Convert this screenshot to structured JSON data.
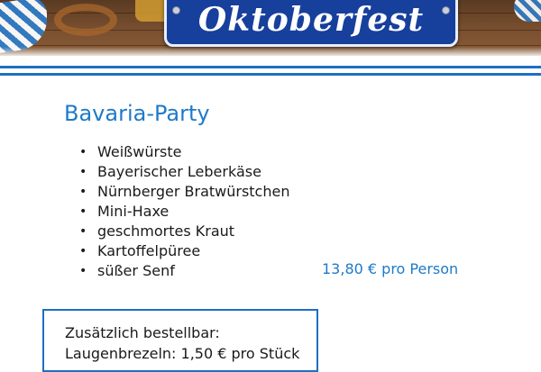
{
  "banner": {
    "title": "Oktoberfest"
  },
  "menu": {
    "title": "Bavaria-Party",
    "bullet": "•",
    "items": [
      "Weißwürste",
      "Bayerischer Leberkäse",
      "Nürnberger Bratwürstchen",
      "Mini-Haxe",
      "geschmortes Kraut",
      "Kartoffelpüree",
      "süßer Senf"
    ],
    "price": "13,80 € pro Person"
  },
  "extras": {
    "heading": "Zusätzlich bestellbar:",
    "line": "Laugenbrezeln: 1,50 € pro Stück"
  },
  "colors": {
    "accent": "#1e7ac9",
    "rule": "#1e6fc2",
    "sign": "#173f9c"
  }
}
